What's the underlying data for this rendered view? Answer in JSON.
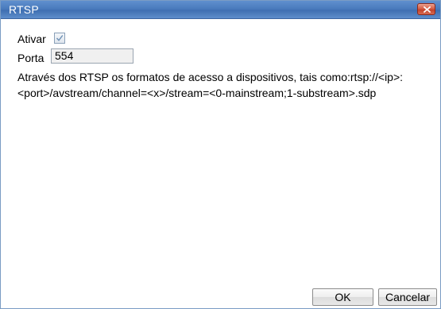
{
  "window": {
    "title": "RTSP",
    "close_icon": "close-icon"
  },
  "form": {
    "enable_label": "Ativar",
    "enable_checked": true,
    "port_label": "Porta",
    "port_value": "554"
  },
  "description": {
    "line1": "Através dos RTSP os formatos de acesso a dispositivos, tais como:rtsp://<ip>:",
    "line2": "<port>/avstream/channel=<x>/stream=<0-mainstream;1-substream>.sdp"
  },
  "buttons": {
    "ok_label": "OK",
    "cancel_label": "Cancelar"
  },
  "colors": {
    "titlebar": "#4a7bbd",
    "close": "#d4583f"
  }
}
